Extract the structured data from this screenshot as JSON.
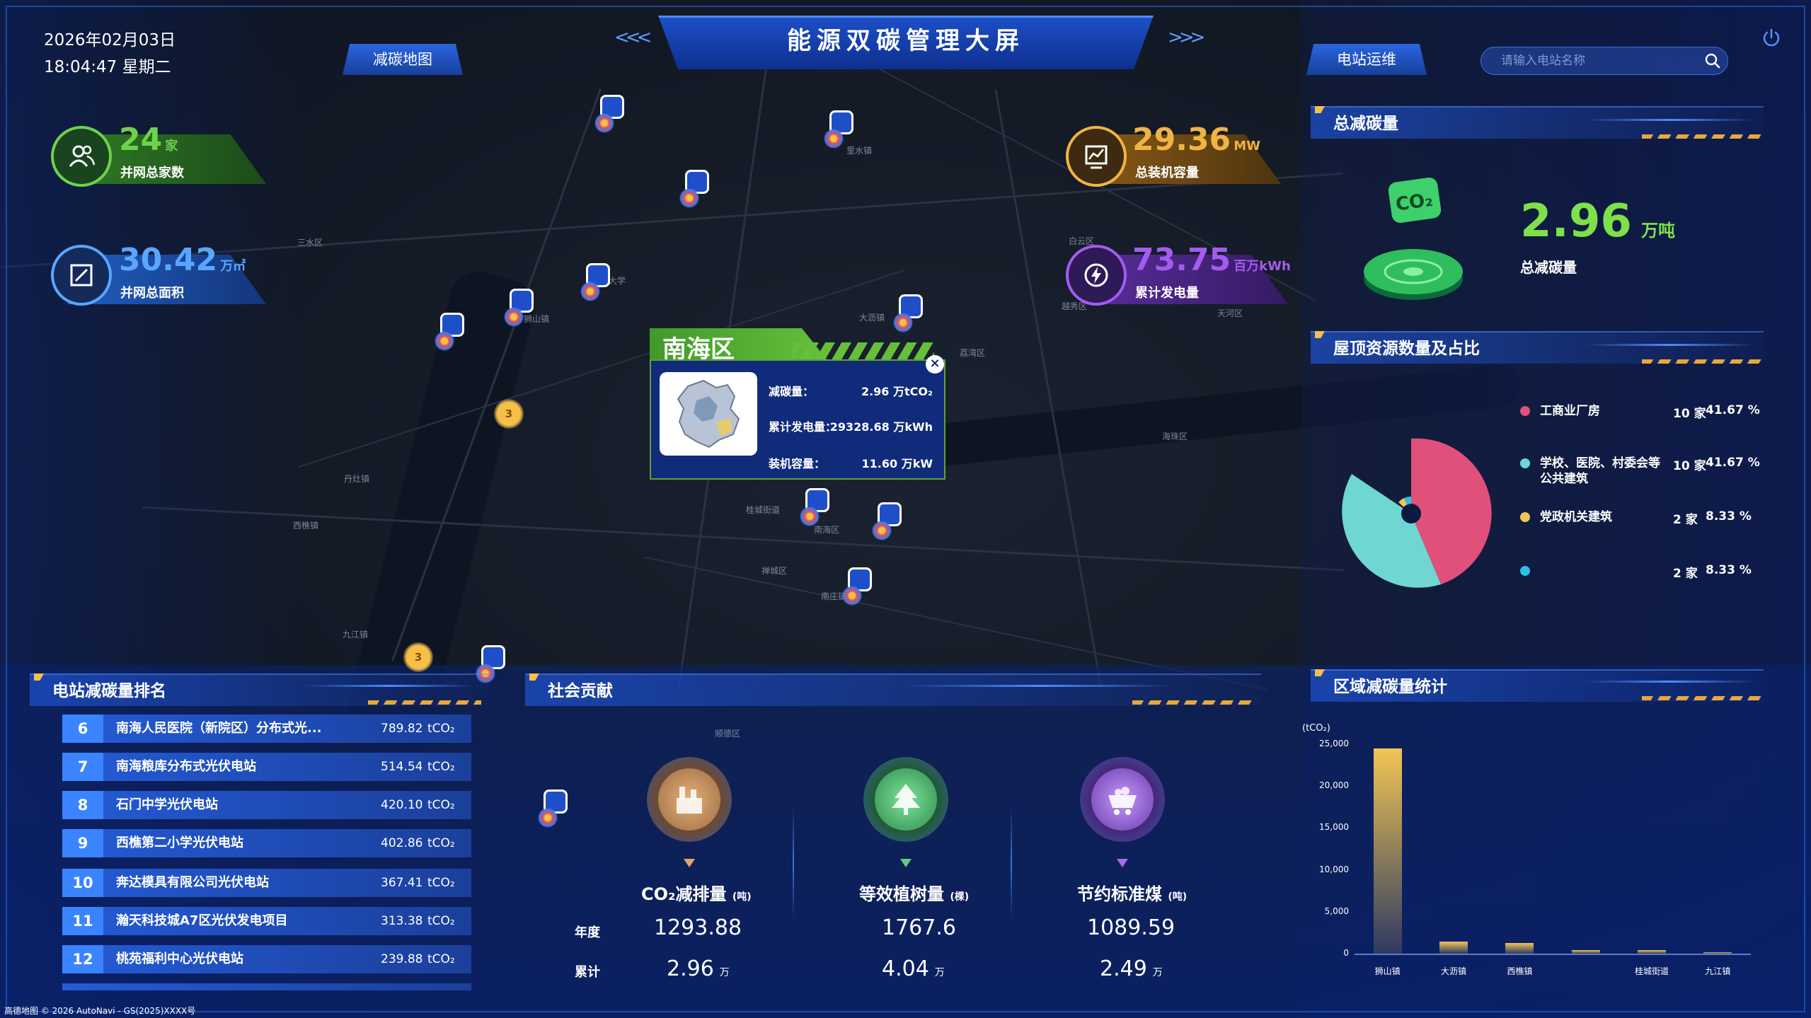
{
  "header": {
    "date": "2026年02月03日",
    "time": "18:04:47 星期二",
    "title": "能源双碳管理大屏",
    "tab_left": "减碳地图",
    "tab_right": "电站运维",
    "search_placeholder": "请输入电站名称"
  },
  "stats": {
    "connected_count": {
      "value": "24",
      "unit": "家",
      "label": "并网总家数",
      "color": "#6ed24a"
    },
    "connected_area": {
      "value": "30.42",
      "unit": "万㎡",
      "label": "并网总面积",
      "color": "#5aa6ff"
    },
    "installed_capacity": {
      "value": "29.36",
      "unit": "MW",
      "label": "总装机容量",
      "color": "#f0b443"
    },
    "cumulative_generation": {
      "value": "73.75",
      "unit": "百万kWh",
      "label": "累计发电量",
      "color": "#a45bf0"
    }
  },
  "map": {
    "labels": [
      "三水区",
      "南海区",
      "顺德区",
      "禅城区",
      "海珠区",
      "越秀区",
      "白云区",
      "天河区",
      "荔湾区",
      "大沥镇",
      "狮山镇",
      "丹灶镇",
      "西樵镇",
      "九江镇",
      "桂城街道",
      "里水镇",
      "佛山大学",
      "南庄镇"
    ],
    "clusters": [
      "3",
      "3"
    ],
    "popup": {
      "title": "南海区",
      "rows": [
        {
          "label": "减碳量：",
          "value": "2.96 万tCO₂"
        },
        {
          "label": "累计发电量：",
          "value": "29328.68 万kWh"
        },
        {
          "label": "装机容量：",
          "value": "11.60 万kW"
        }
      ]
    }
  },
  "total_reduction": {
    "title": "总减碳量",
    "value": "2.96",
    "unit": "万吨",
    "label": "总减碳量",
    "icon_text": "CO₂",
    "color": "#7ee04a"
  },
  "rooftop": {
    "title": "屋顶资源数量及占比",
    "items": [
      {
        "name": "工商业厂房",
        "count": "10 家",
        "pct": "41.67 %",
        "color": "#e0507a",
        "share": 41.67
      },
      {
        "name": "学校、医院、村委会等公共建筑",
        "count": "10 家",
        "pct": "41.67 %",
        "color": "#6fd6d2",
        "share": 41.67
      },
      {
        "name": "党政机关建筑",
        "count": "2 家",
        "pct": "8.33 %",
        "color": "#f2c656",
        "share": 8.33
      },
      {
        "name": "",
        "count": "2 家",
        "pct": "8.33 %",
        "color": "#27c1e6",
        "share": 8.33
      }
    ]
  },
  "ranking": {
    "title": "电站减碳量排名",
    "unit": "tCO₂",
    "rows": [
      {
        "rank": "6",
        "name": "南海人民医院（新院区）分布式光...",
        "value": "789.82"
      },
      {
        "rank": "7",
        "name": "南海粮库分布式光伏电站",
        "value": "514.54"
      },
      {
        "rank": "8",
        "name": "石门中学光伏电站",
        "value": "420.10"
      },
      {
        "rank": "9",
        "name": "西樵第二小学光伏电站",
        "value": "402.86"
      },
      {
        "rank": "10",
        "name": "奔达模具有限公司光伏电站",
        "value": "367.41"
      },
      {
        "rank": "11",
        "name": "瀚天科技城A7区光伏发电项目",
        "value": "313.38"
      },
      {
        "rank": "12",
        "name": "桃苑福利中心光伏电站",
        "value": "239.88"
      }
    ]
  },
  "social": {
    "title": "社会贡献",
    "row_annual": "年度",
    "row_total": "累计",
    "items": [
      {
        "label": "CO₂减排量",
        "unit": "(吨)",
        "annual": "1293.88",
        "total": "2.96",
        "total_unit": "万",
        "color": "#e0a66a",
        "icon": "factory-icon"
      },
      {
        "label": "等效植树量",
        "unit": "(棵)",
        "annual": "1767.6",
        "total": "4.04",
        "total_unit": "万",
        "color": "#5ed07a",
        "icon": "tree-icon"
      },
      {
        "label": "节约标准煤",
        "unit": "(吨)",
        "annual": "1089.59",
        "total": "2.49",
        "total_unit": "万",
        "color": "#a56bf0",
        "icon": "coal-cart-icon"
      }
    ]
  },
  "region_chart": {
    "title": "区域减碳量统计",
    "unit_label": "(tCO₂)"
  },
  "chart_data": {
    "type": "bar",
    "title": "区域减碳量统计",
    "ylabel": "(tCO₂)",
    "categories": [
      "狮山镇",
      "大沥镇",
      "西樵镇",
      "",
      "桂城街道",
      "九江镇"
    ],
    "values": [
      24500,
      1400,
      1300,
      450,
      400,
      180
    ],
    "ylim": [
      0,
      25000
    ],
    "yticks": [
      "0",
      "5,000",
      "10,000",
      "15,000",
      "20,000",
      "25,000"
    ],
    "tick_values": [
      0,
      5000,
      10000,
      15000,
      20000,
      25000
    ],
    "grid": false
  },
  "footer": {
    "text": "高德地图 © 2026 AutoNavi - GS(2025)XXXX号"
  }
}
